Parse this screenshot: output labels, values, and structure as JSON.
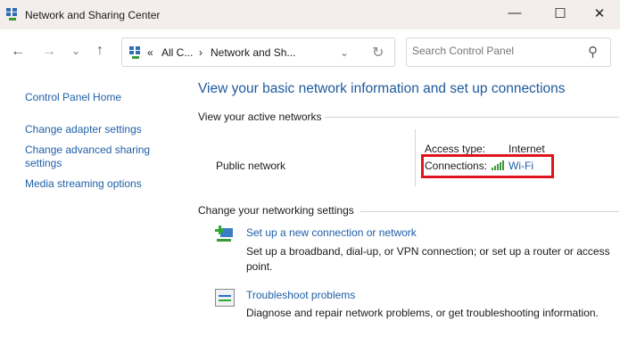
{
  "window": {
    "title": "Network and Sharing Center",
    "minimize": "—",
    "maximize": "☐",
    "close": "✕"
  },
  "nav": {
    "back": "←",
    "forward": "→",
    "recent": "⌄",
    "up": "↑"
  },
  "address": {
    "overflow": "«",
    "crumb1": "All C...",
    "sep": "›",
    "crumb2": "Network and Sh...",
    "dropdown": "⌄",
    "refresh": "↻"
  },
  "search": {
    "placeholder": "Search Control Panel",
    "icon": "⚲"
  },
  "sidebar": {
    "items": [
      {
        "label": "Control Panel Home"
      },
      {
        "label": "Change adapter settings"
      },
      {
        "label": "Change advanced sharing settings"
      },
      {
        "label": "Media streaming options"
      }
    ]
  },
  "main": {
    "heading": "View your basic network information and set up connections",
    "active_networks": "View your active networks",
    "network_name": "Public network",
    "access_type_label": "Access type:",
    "access_type_value": "Internet",
    "connections_label": "Connections:",
    "connections_value": "Wi-Fi",
    "change_settings": "Change your networking settings",
    "tasks": [
      {
        "title": "Set up a new connection or network",
        "desc": "Set up a broadband, dial-up, or VPN connection; or set up a router or access point."
      },
      {
        "title": "Troubleshoot problems",
        "desc": "Diagnose and repair network problems, or get troubleshooting information."
      }
    ]
  },
  "colors": {
    "link": "#1f5fa8",
    "heading": "#1e5a9c",
    "highlight": "#e0141e"
  }
}
